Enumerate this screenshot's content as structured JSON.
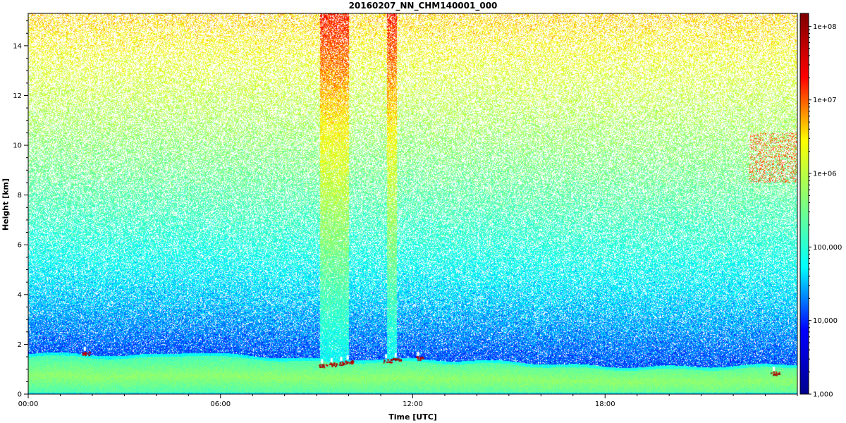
{
  "chart_data": {
    "type": "heatmap",
    "title": "20160207_NN_CHM140001_000",
    "xlabel": "Time [UTC]",
    "ylabel": "Height [km]",
    "x_ticks": [
      "00:00",
      "06:00",
      "12:00",
      "18:00"
    ],
    "x_tick_hours": [
      0,
      6,
      12,
      18
    ],
    "xlim_hours": [
      0,
      24
    ],
    "y_ticks": [
      0,
      2,
      4,
      6,
      8,
      10,
      12,
      14
    ],
    "ylim": [
      0,
      15.3
    ],
    "colorbar": {
      "scale": "log",
      "range": [
        1000,
        150000000
      ],
      "tick_values": [
        1000,
        10000,
        100000,
        1000000,
        10000000,
        100000000
      ],
      "tick_labels": [
        "1,000",
        "10,000",
        "100,000",
        "1e+06",
        "1e+07",
        "1e+08"
      ],
      "colors": [
        "#00008f",
        "#0000ff",
        "#00ffff",
        "#80ff80",
        "#ffff00",
        "#ff0000",
        "#800000"
      ]
    },
    "features": {
      "boundary_layer_top_km": [
        {
          "hour": 0,
          "km": 1.6
        },
        {
          "hour": 1.5,
          "km": 1.65
        },
        {
          "hour": 3,
          "km": 1.5
        },
        {
          "hour": 5,
          "km": 1.7
        },
        {
          "hour": 6,
          "km": 1.6
        },
        {
          "hour": 9,
          "km": 1.4
        },
        {
          "hour": 12,
          "km": 1.4
        },
        {
          "hour": 15,
          "km": 1.3
        },
        {
          "hour": 18,
          "km": 1.1
        },
        {
          "hour": 21,
          "km": 1.1
        },
        {
          "hour": 24,
          "km": 1.2
        }
      ],
      "cloud_bases": [
        {
          "hour": 1.8,
          "km": 1.65
        },
        {
          "hour": 9.2,
          "km": 1.15
        },
        {
          "hour": 9.5,
          "km": 1.2
        },
        {
          "hour": 9.8,
          "km": 1.25
        },
        {
          "hour": 10.0,
          "km": 1.3
        },
        {
          "hour": 11.2,
          "km": 1.35
        },
        {
          "hour": 11.5,
          "km": 1.4
        },
        {
          "hour": 12.2,
          "km": 1.45
        },
        {
          "hour": 23.3,
          "km": 0.85
        }
      ],
      "precipitation_columns_hours": [
        [
          9.1,
          10.0
        ],
        [
          11.2,
          11.5
        ]
      ],
      "elevated_layer": {
        "hours": [
          22.5,
          24
        ],
        "km": [
          8.5,
          10.5
        ]
      }
    }
  }
}
